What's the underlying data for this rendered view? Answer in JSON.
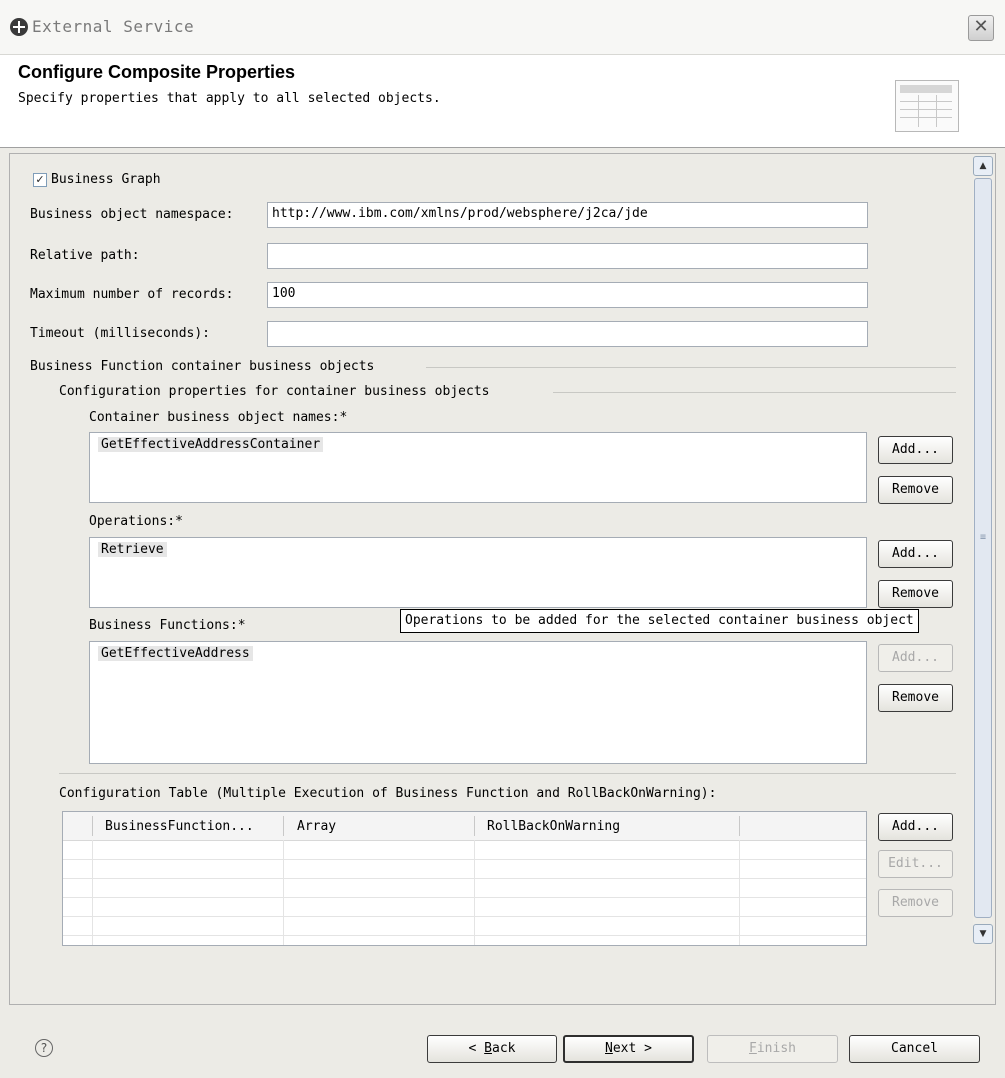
{
  "window": {
    "title": "External Service",
    "close_glyph": "✕"
  },
  "header": {
    "title": "Configure Composite Properties",
    "description": "Specify properties that apply to all selected objects.",
    "graphic_icon": "table-wizard-icon"
  },
  "form": {
    "business_graph": {
      "label": "Business Graph",
      "checked": true,
      "glyph": "✓"
    },
    "namespace": {
      "label": "Business object namespace:",
      "value": "http://www.ibm.com/xmlns/prod/websphere/j2ca/jde"
    },
    "relative_path": {
      "label": "Relative path:",
      "value": ""
    },
    "max_records": {
      "label": "Maximum number of records:",
      "value": "100"
    },
    "timeout": {
      "label": "Timeout (milliseconds):",
      "value": ""
    }
  },
  "container_section": {
    "group_label": "Business Function container business objects",
    "sub_group_label": "Configuration properties for container business objects",
    "container_names": {
      "label": "Container business object names:*",
      "items": [
        "GetEffectiveAddressContainer"
      ],
      "add": "Add...",
      "remove": "Remove"
    },
    "operations": {
      "label": "Operations:*",
      "items": [
        "Retrieve"
      ],
      "add": "Add...",
      "remove": "Remove"
    },
    "business_functions": {
      "label": "Business Functions:*",
      "items": [
        "GetEffectiveAddress"
      ],
      "add": "Add...",
      "remove": "Remove"
    },
    "tooltip": "Operations to be added for the selected container business object"
  },
  "config_table": {
    "label": "Configuration Table (Multiple Execution of Business Function and RollBackOnWarning):",
    "columns": [
      "BusinessFunction...",
      "Array",
      "RollBackOnWarning"
    ],
    "rows": [],
    "add": "Add...",
    "edit": "Edit...",
    "remove": "Remove"
  },
  "scrollbar": {
    "up_glyph": "▲",
    "down_glyph": "▼",
    "grip_glyph": "≡"
  },
  "footer": {
    "help_glyph": "?",
    "back": {
      "prefix": "< ",
      "mnemonic": "B",
      "rest": "ack"
    },
    "next": {
      "mnemonic": "N",
      "rest": "ext >"
    },
    "finish": {
      "mnemonic": "F",
      "rest": "inish"
    },
    "cancel": "Cancel"
  }
}
